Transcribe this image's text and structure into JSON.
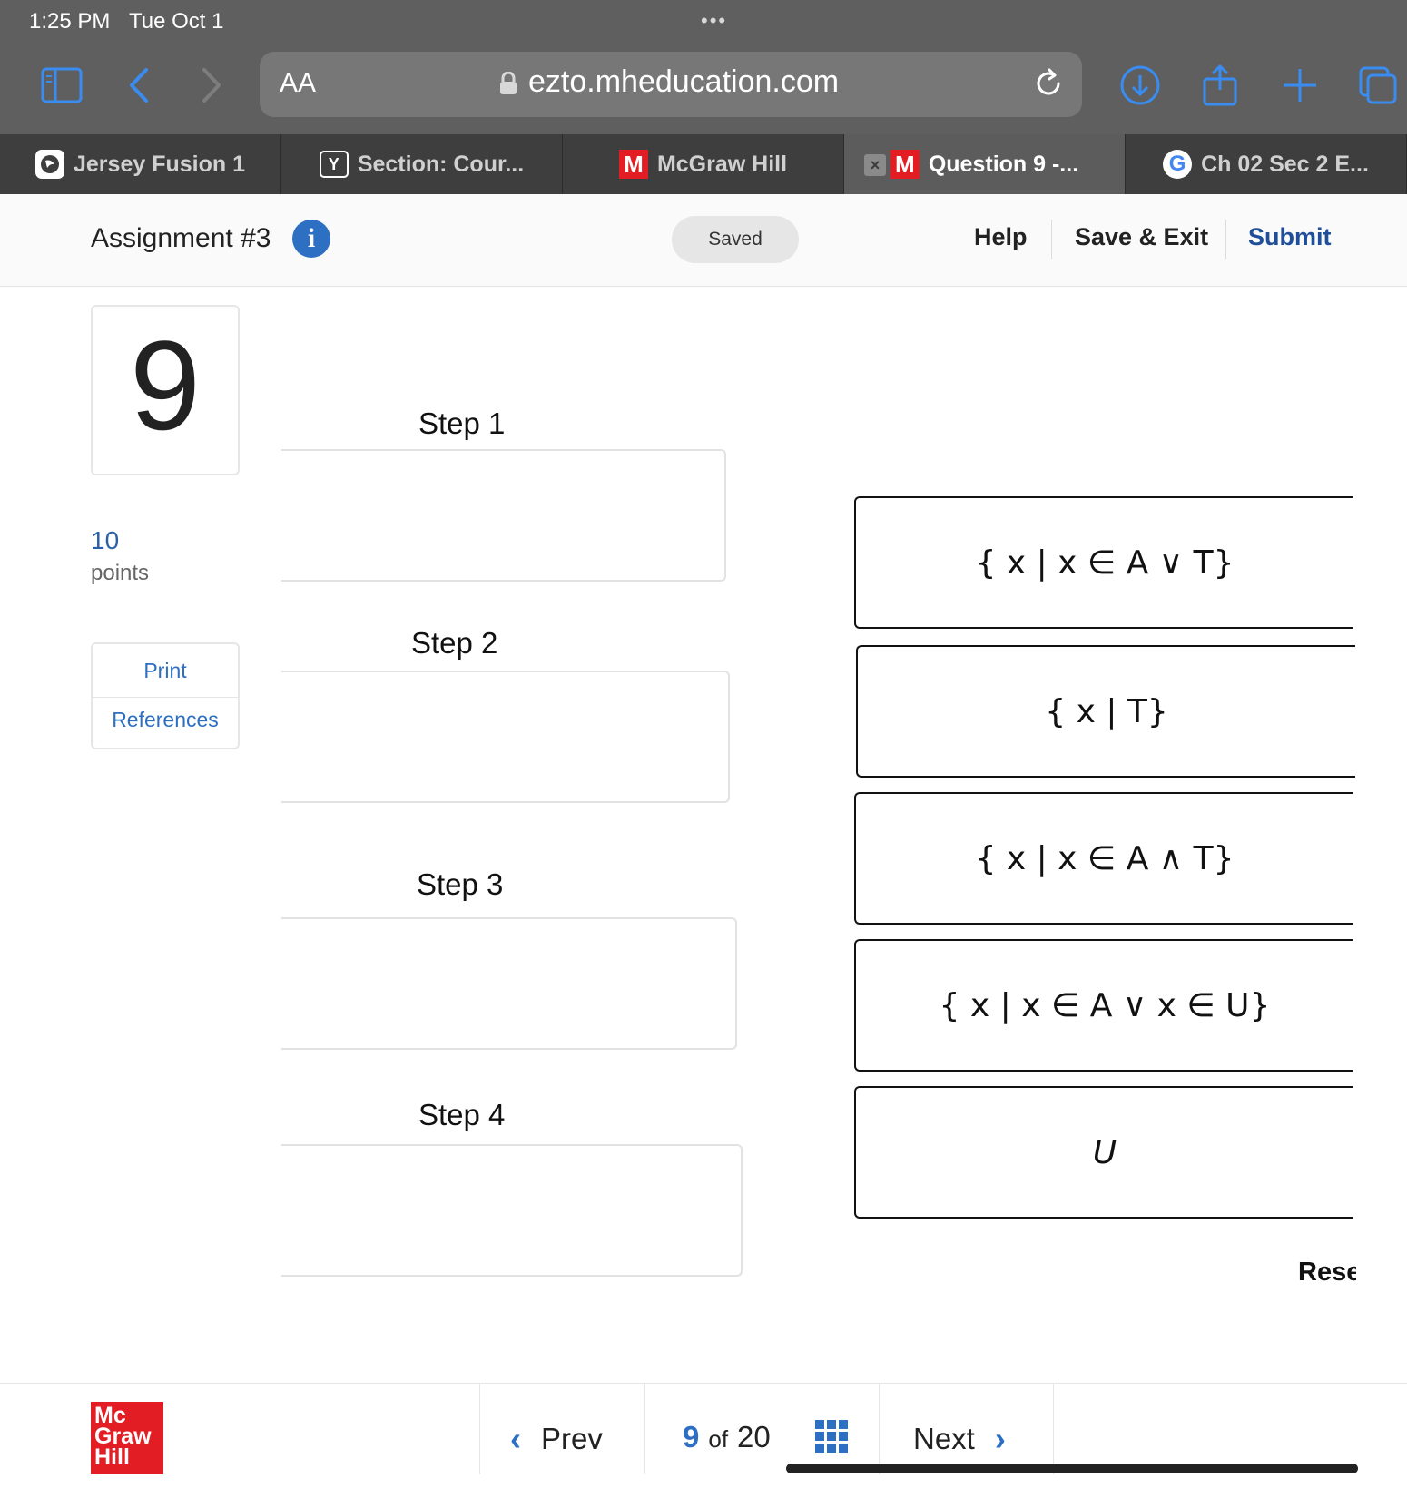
{
  "status": {
    "time": "1:25 PM",
    "date": "Tue Oct 1",
    "dots": "•••"
  },
  "browser": {
    "text_size_label": "AA",
    "url": "ezto.mheducation.com",
    "accent_color": "#2d6fc2"
  },
  "tabs": [
    {
      "title": "Jersey Fusion 1",
      "favicon": "jersey-fusion-favicon"
    },
    {
      "title": "Section: Cour...",
      "favicon_text": "Y"
    },
    {
      "title": "McGraw Hill",
      "favicon_text": "M"
    },
    {
      "title": "Question 9 -...",
      "favicon_text": "M",
      "active": true,
      "close_glyph": "×"
    },
    {
      "title": "Ch 02 Sec 2 E...",
      "favicon_text": "G"
    }
  ],
  "header": {
    "assignment_title": "Assignment #3",
    "info_glyph": "i",
    "saved_label": "Saved",
    "help_label": "Help",
    "save_exit_label": "Save & Exit",
    "submit_label": "Submit"
  },
  "question": {
    "number": "9",
    "points_value": "10",
    "points_label": "points",
    "print_label": "Print",
    "references_label": "References"
  },
  "steps": [
    {
      "label": "Step 1"
    },
    {
      "label": "Step 2"
    },
    {
      "label": "Step 3"
    },
    {
      "label": "Step 4"
    }
  ],
  "options": [
    {
      "text": "{ x | x ∈ A ∨ T}"
    },
    {
      "text": "{ x | T}"
    },
    {
      "text": "{ x | x ∈ A ∧ T}"
    },
    {
      "text": "{ x | x ∈ A ∨ x ∈ U}"
    },
    {
      "text": "U"
    }
  ],
  "reset_label": "Reset",
  "footer": {
    "logo_lines": [
      "Mc",
      "Graw",
      "Hill"
    ],
    "prev_label": "Prev",
    "next_label": "Next",
    "current_page": "9",
    "of_label": "of",
    "total_pages": "20"
  }
}
